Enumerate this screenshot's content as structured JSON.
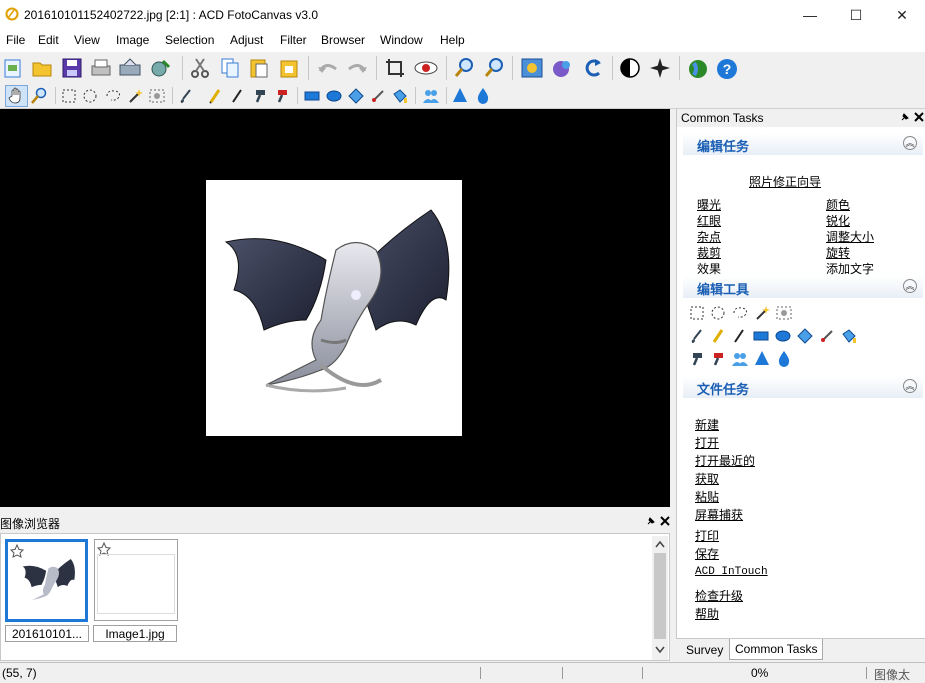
{
  "window": {
    "title": "201610101152402722.jpg [2:1] : ACD FotoCanvas v3.0",
    "minimize": "—",
    "maximize": "☐",
    "close": "✕"
  },
  "menu": [
    "File",
    "Edit",
    "View",
    "Image",
    "Selection",
    "Adjust",
    "Filter",
    "Browser",
    "Window",
    "Help"
  ],
  "browser": {
    "title": "图像浏览器",
    "thumbnails": [
      {
        "label": "201610101..."
      },
      {
        "label": "Image1.jpg"
      }
    ]
  },
  "tasks": {
    "title": "Common Tasks",
    "edit_tasks": {
      "header": "编辑任务",
      "wizard": "照片修正向导",
      "left": [
        "曝光",
        "红眼",
        "杂点",
        "裁剪",
        "效果"
      ],
      "right": [
        "颜色",
        "锐化",
        "调整大小",
        "旋转",
        "添加文字"
      ]
    },
    "edit_tools": {
      "header": "编辑工具"
    },
    "file_tasks": {
      "header": "文件任务",
      "items": [
        "新建",
        "打开",
        "打开最近的",
        "获取",
        "粘贴",
        "屏幕捕获",
        "打印",
        "保存",
        "ACD InTouch",
        "检查升级",
        "帮助"
      ]
    },
    "tabs": [
      "Survey",
      "Common Tasks"
    ]
  },
  "status": {
    "coords": "(55, 7)",
    "progress": "0%",
    "right_text": "图像太"
  },
  "colors": {
    "accent": "#1a5fb4",
    "canvas_bg": "#000000",
    "selection_border": "#1e78d7"
  }
}
